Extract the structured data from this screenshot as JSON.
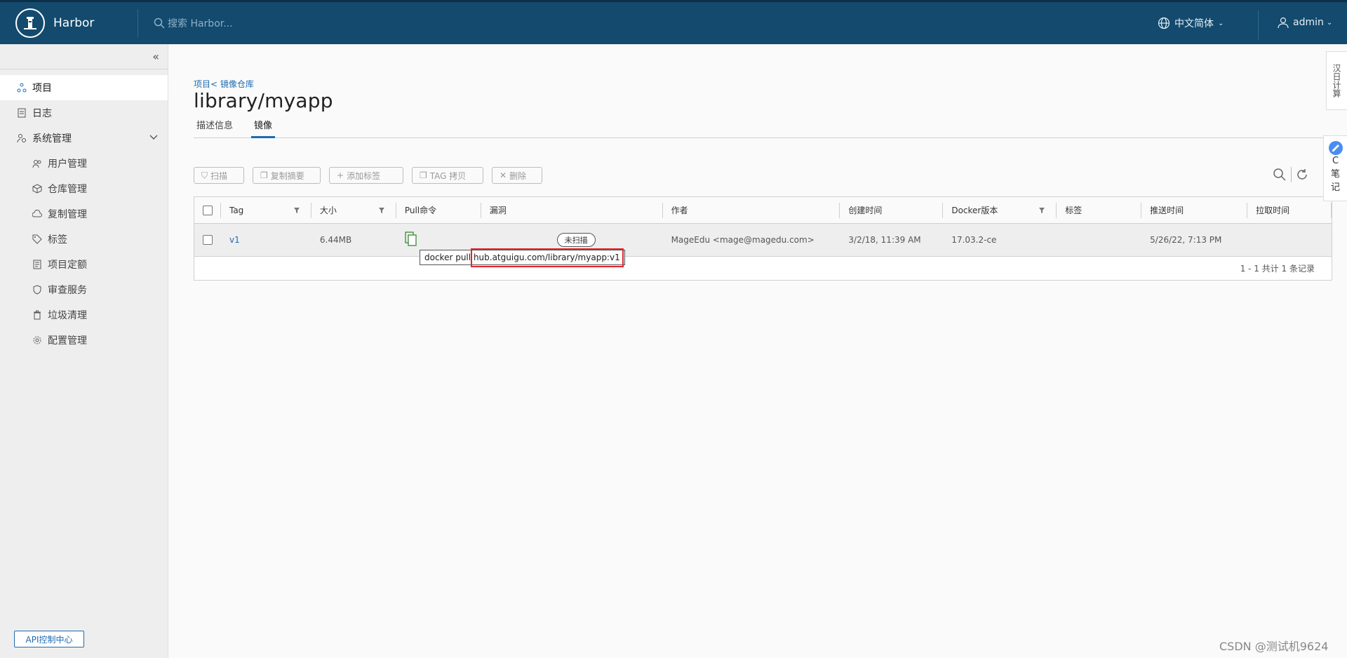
{
  "header": {
    "brand": "Harbor",
    "search_placeholder": "搜索 Harbor...",
    "language": "中文简体",
    "user": "admin"
  },
  "sidebar": {
    "items": [
      {
        "label": "项目"
      },
      {
        "label": "日志"
      },
      {
        "label": "系统管理"
      },
      {
        "label": "用户管理"
      },
      {
        "label": "仓库管理"
      },
      {
        "label": "复制管理"
      },
      {
        "label": "标签"
      },
      {
        "label": "项目定额"
      },
      {
        "label": "审查服务"
      },
      {
        "label": "垃圾清理"
      },
      {
        "label": "配置管理"
      }
    ],
    "api_button": "API控制中心"
  },
  "main": {
    "breadcrumb": "项目< 镜像仓库",
    "title": "library/myapp",
    "tabs": [
      "描述信息",
      "镜像"
    ],
    "toolbar": [
      "扫描",
      "复制摘要",
      "添加标签",
      "TAG 拷贝",
      "删除"
    ],
    "table": {
      "headers": [
        "Tag",
        "大小",
        "Pull命令",
        "漏洞",
        "作者",
        "创建时间",
        "Docker版本",
        "标签",
        "推送时间",
        "拉取时间"
      ],
      "rows": [
        {
          "tag": "v1",
          "size": "6.44MB",
          "vuln": "未扫描",
          "author": "MageEdu <mage@magedu.com>",
          "created": "3/2/18, 11:39 AM",
          "docker": "17.03.2-ce",
          "labels": "",
          "pushed": "5/26/22, 7:13 PM",
          "pulled": ""
        }
      ],
      "footer": "1 - 1 共计 1 条记录"
    },
    "tooltip": {
      "cmd": "docker pull",
      "url": "hub.atguigu.com/library/myapp:v1"
    }
  },
  "widgets": {
    "right_tab1": "汉日计算",
    "right_tab2_c": "C",
    "right_tab2_1": "笔",
    "right_tab2_2": "记",
    "watermark": "CSDN @测试机9624"
  }
}
